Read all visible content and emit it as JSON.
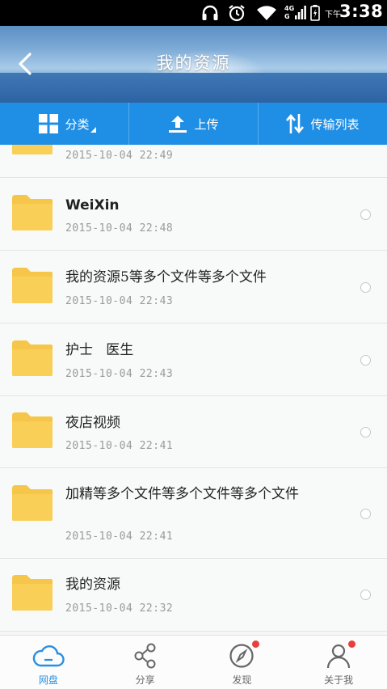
{
  "status_bar": {
    "time_prefix": "下午",
    "time": "3:38",
    "network_top": "4G",
    "network_bottom": "G",
    "icons": [
      "headphones-icon",
      "alarm-icon",
      "wifi-icon",
      "signal-icon",
      "battery-icon"
    ]
  },
  "header": {
    "title": "我的资源",
    "back_icon": "chevron-left-icon"
  },
  "toolbar": {
    "category_label": "分类",
    "upload_label": "上传",
    "transfer_label": "传输列表"
  },
  "files": [
    {
      "name": "",
      "date": "2015-10-04   22:49",
      "partial": true
    },
    {
      "name": "WeiXin",
      "date": "2015-10-04   22:48"
    },
    {
      "name": "我的资源5等多个文件等多个文件",
      "date": "2015-10-04   22:43"
    },
    {
      "name": "护士   医生",
      "date": "2015-10-04   22:43"
    },
    {
      "name": "夜店视频",
      "date": "2015-10-04   22:41"
    },
    {
      "name": "加精等多个文件等多个文件等多个文件",
      "date": "2015-10-04   22:41"
    },
    {
      "name": "我的资源",
      "date": "2015-10-04   22:32"
    }
  ],
  "bottom_nav": {
    "items": [
      {
        "label": "网盘",
        "icon": "cloud-icon",
        "active": true,
        "badge": false
      },
      {
        "label": "分享",
        "icon": "share-icon",
        "active": false,
        "badge": false
      },
      {
        "label": "发现",
        "icon": "compass-icon",
        "active": false,
        "badge": true
      },
      {
        "label": "关于我",
        "icon": "user-icon",
        "active": false,
        "badge": true
      }
    ]
  },
  "colors": {
    "accent": "#1f8fe6",
    "folder": "#f6c64a",
    "badge": "#e8403e",
    "active_nav": "#2a8fe3"
  }
}
